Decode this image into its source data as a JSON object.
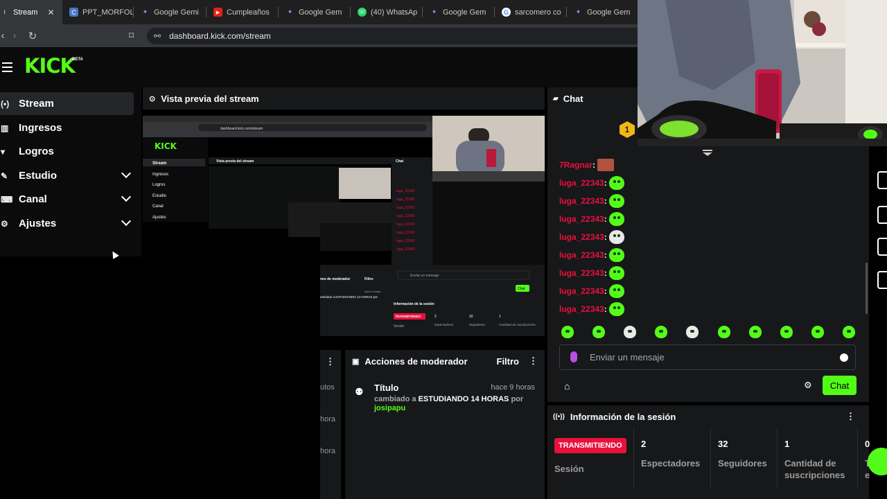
{
  "browser": {
    "tabs": [
      {
        "label": "Stream",
        "fav_color": "#53fc18",
        "fav_glyph": "≀",
        "active": true
      },
      {
        "label": "PPT_MORFOL",
        "fav_color": "#4a78c7",
        "fav_glyph": "C"
      },
      {
        "label": "Google Gemi",
        "fav_color": "transparent",
        "fav_glyph": "✦"
      },
      {
        "label": "Cumpleaños",
        "fav_color": "#e62117",
        "fav_glyph": "▶"
      },
      {
        "label": "Google Gem",
        "fav_color": "transparent",
        "fav_glyph": "✦"
      },
      {
        "label": "(40) WhatsAp",
        "fav_color": "#25d366",
        "fav_glyph": "☏"
      },
      {
        "label": "Google Gem",
        "fav_color": "transparent",
        "fav_glyph": "✦"
      },
      {
        "label": "sarcomero co",
        "fav_color": "#fff",
        "fav_glyph": "G"
      },
      {
        "label": "Google Gem",
        "fav_color": "transparent",
        "fav_glyph": "✦"
      }
    ],
    "url": "dashboard.kick.com/stream"
  },
  "kick": {
    "logo": "KICK",
    "beta": "BETA",
    "accent": "#53fc18"
  },
  "sidebar": {
    "items": [
      {
        "label": "Stream",
        "icon": "broadcast-icon",
        "glyph": "(•)"
      },
      {
        "label": "Ingresos",
        "icon": "chart-icon",
        "glyph": "▥"
      },
      {
        "label": "Logros",
        "icon": "trophy-icon",
        "glyph": "🏆"
      },
      {
        "label": "Estudio",
        "icon": "studio-icon",
        "glyph": "✎"
      },
      {
        "label": "Canal",
        "icon": "channel-icon",
        "glyph": "⌨"
      },
      {
        "label": "Ajustes",
        "icon": "gear-icon",
        "glyph": "⚙"
      }
    ]
  },
  "preview": {
    "title": "Vista previa del stream",
    "mini": {
      "url": "dashboard.kick.com/stream",
      "nav": [
        "Stream",
        "Ingresos",
        "Logros",
        "Estudio",
        "Canal",
        "Ajustes"
      ],
      "title": "Vista previa del stream",
      "chat": "Chat",
      "placeholder": "Enviar un mensaje",
      "send": "Chat",
      "session": "Información de la sesión",
      "live": "TRANSMITIENDO",
      "sesion": "Sesión",
      "n1": "2",
      "l1": "Espectadores",
      "n2": "32",
      "l2": "Seguidores",
      "n3": "1",
      "l3": "Cantidad de suscripciones",
      "mod": "nes de moderador",
      "filtro": "Filtro",
      "time": "hace 9 horas",
      "mod_text": "ambiado a ESTUDIANDO 14 HORAS por"
    }
  },
  "moderator": {
    "title": "Acciones de moderador",
    "filter": "Filtro",
    "left_fragments": [
      "utos",
      "hora",
      "hora"
    ],
    "entry": {
      "title": "Título",
      "time": "hace 9 horas",
      "prefix": "cambiado a",
      "new_title": "ESTUDIANDO 14 HORAS",
      "by": "por",
      "user": "josipapu"
    }
  },
  "chat": {
    "title": "Chat",
    "pin_count": "1",
    "messages": [
      {
        "user": "7Ragnar",
        "emote": "photo"
      },
      {
        "user": "luga_22343",
        "emote": "green"
      },
      {
        "user": "luga_22343",
        "emote": "green"
      },
      {
        "user": "luga_22343",
        "emote": "green"
      },
      {
        "user": "luga_22343",
        "emote": "white"
      },
      {
        "user": "luga_22343",
        "emote": "green"
      },
      {
        "user": "luga_22343",
        "emote": "green"
      },
      {
        "user": "luga_22343",
        "emote": "green"
      },
      {
        "user": "luga_22343",
        "emote": "green"
      }
    ],
    "emote_bar": [
      "green",
      "green",
      "white",
      "green",
      "white",
      "green",
      "green",
      "green",
      "green",
      "green"
    ],
    "input_placeholder": "Enviar un mensaje",
    "send_label": "Chat"
  },
  "session": {
    "title": "Información de la sesión",
    "live_badge": "TRANSMITIENDO",
    "session_label": "Sesión",
    "stats": [
      {
        "value": "2",
        "label": "Espectadores"
      },
      {
        "value": "32",
        "label": "Seguidores"
      },
      {
        "value": "1",
        "label": "Cantidad de suscripciones"
      },
      {
        "value": "0",
        "label": "T e"
      }
    ]
  }
}
